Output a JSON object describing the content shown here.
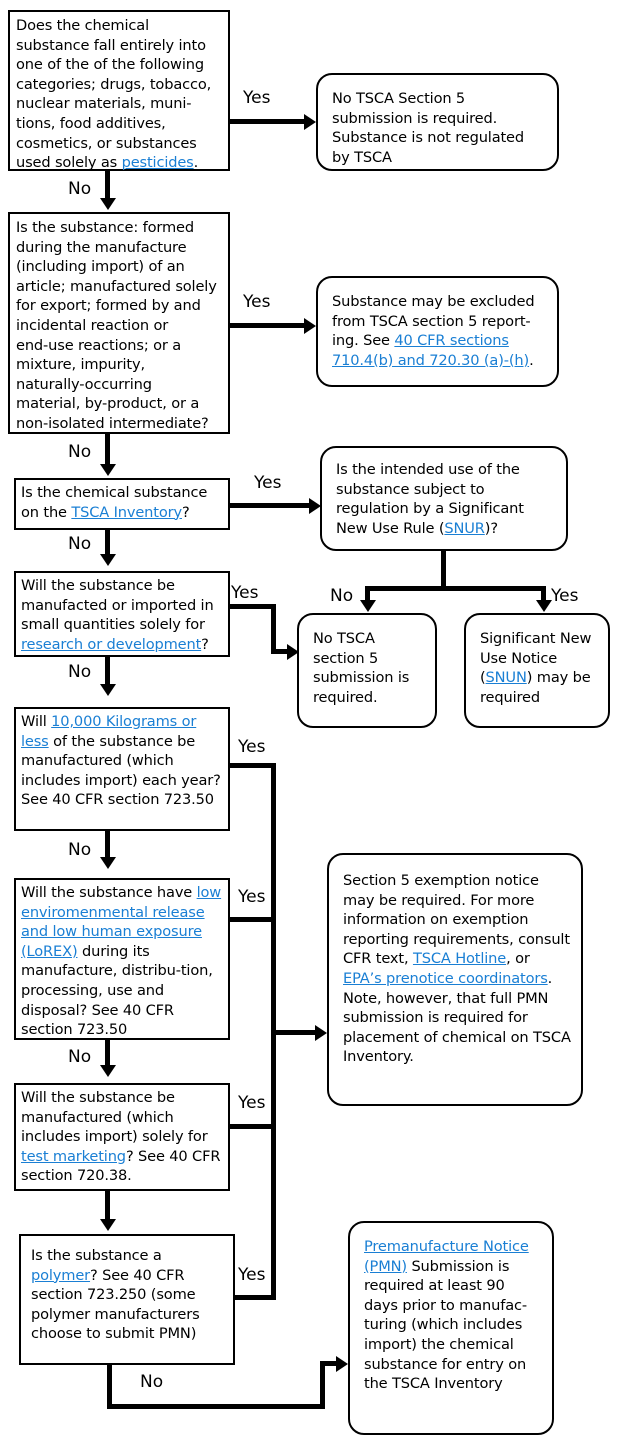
{
  "title": "TSCA Section 5 Submission Decision Flowchart",
  "colors": {
    "link": "#1a7fd4",
    "stroke": "#000000",
    "background": "#ffffff"
  },
  "edge_labels": {
    "yes": "Yes",
    "no": "No"
  },
  "nodes": {
    "q1_categories": {
      "shape": "rectangle",
      "lines": [
        "Does the chemical",
        "substance fall entirely into",
        "one of the of the following",
        "categories; drugs, tobacco,",
        "nuclear materials, muni-",
        "tions, food additives,",
        "cosmetics, or substances",
        "used solely as "
      ],
      "link": "pesticides",
      "tail": "."
    },
    "a1_no_submission": {
      "shape": "rounded",
      "text": "No TSCA Section 5 submission is required. Substance is not regulated by TSCA"
    },
    "q2_exclusions": {
      "shape": "rectangle",
      "lines": [
        "Is the substance: formed",
        "during the manufacture",
        "(including import) of an",
        "article; manufactured solely",
        "for export; formed by and",
        "incidental reaction or",
        "end-use reactions; or a",
        "mixture, impurity,",
        "naturally-occurring",
        "material, by-product, or a",
        "non-isolated intermediate?"
      ]
    },
    "a2_excluded": {
      "shape": "rounded",
      "pre": "Substance may be excluded from TSCA section 5 report-ing. See ",
      "link": "40 CFR sections 710.4(b) and 720.30 (a)-(h)",
      "tail": "."
    },
    "q3_inventory": {
      "shape": "rectangle",
      "pre": "Is the chemical substance on the ",
      "link": "TSCA Inventory",
      "tail": "?"
    },
    "q4_snur": {
      "shape": "rounded",
      "pre": "Is the intended use of the substance subject to regulation by a Significant New Use Rule (",
      "link": "SNUR",
      "tail": ")?"
    },
    "q5_rd": {
      "shape": "rectangle",
      "pre": "Will the substance be manufacted or imported in small quantities solely for ",
      "link": "research or development",
      "tail": "?"
    },
    "a3_no_tsca": {
      "shape": "rounded",
      "text": "No TSCA section 5 submission is required."
    },
    "a4_snun": {
      "shape": "rounded",
      "pre": "Significant New Use Notice (",
      "link": "SNUN",
      "tail": ") may be required"
    },
    "q6_lvex": {
      "shape": "rectangle",
      "pre": "Will ",
      "link": "10,000 Kilograms or less",
      "tail": " of the substance be manufactured (which includes import) each year?  See 40 CFR section 723.50"
    },
    "q7_lorex": {
      "shape": "rectangle",
      "pre": "Will the substance have ",
      "link": "low enviromenmental release and low human exposure (LoREX)",
      "tail": " during its manufacture, distribu-tion, processing, use and disposal? See 40 CFR section 723.50"
    },
    "q8_test_marketing": {
      "shape": "rectangle",
      "pre": "Will the substance be manufactured (which includes import) solely for ",
      "link": "test marketing",
      "tail": "? See 40 CFR section 720.38."
    },
    "q9_polymer": {
      "shape": "rectangle",
      "pre": "Is the substance a ",
      "link": "polymer",
      "tail": "? See 40 CFR section 723.250 (some polymer manufacturers choose to submit PMN)"
    },
    "a5_exemption": {
      "shape": "rounded",
      "seg1": "Section 5 exemption notice may be required. For more information on exemption reporting requirements, consult CFR text, ",
      "link1": "TSCA Hotline",
      "seg2": ", or ",
      "link2": "EPA’s prenotice coordinators",
      "seg3": ". Note, however, that full PMN submission is required for placement of chemical on TSCA Inventory."
    },
    "a6_pmn": {
      "shape": "rounded",
      "link": " Premanufacture Notice (PMN)",
      "tail": " Submission is required at least 90 days prior to manufac-turing (which includes import) the chemical substance for entry on the TSCA Inventory"
    }
  }
}
